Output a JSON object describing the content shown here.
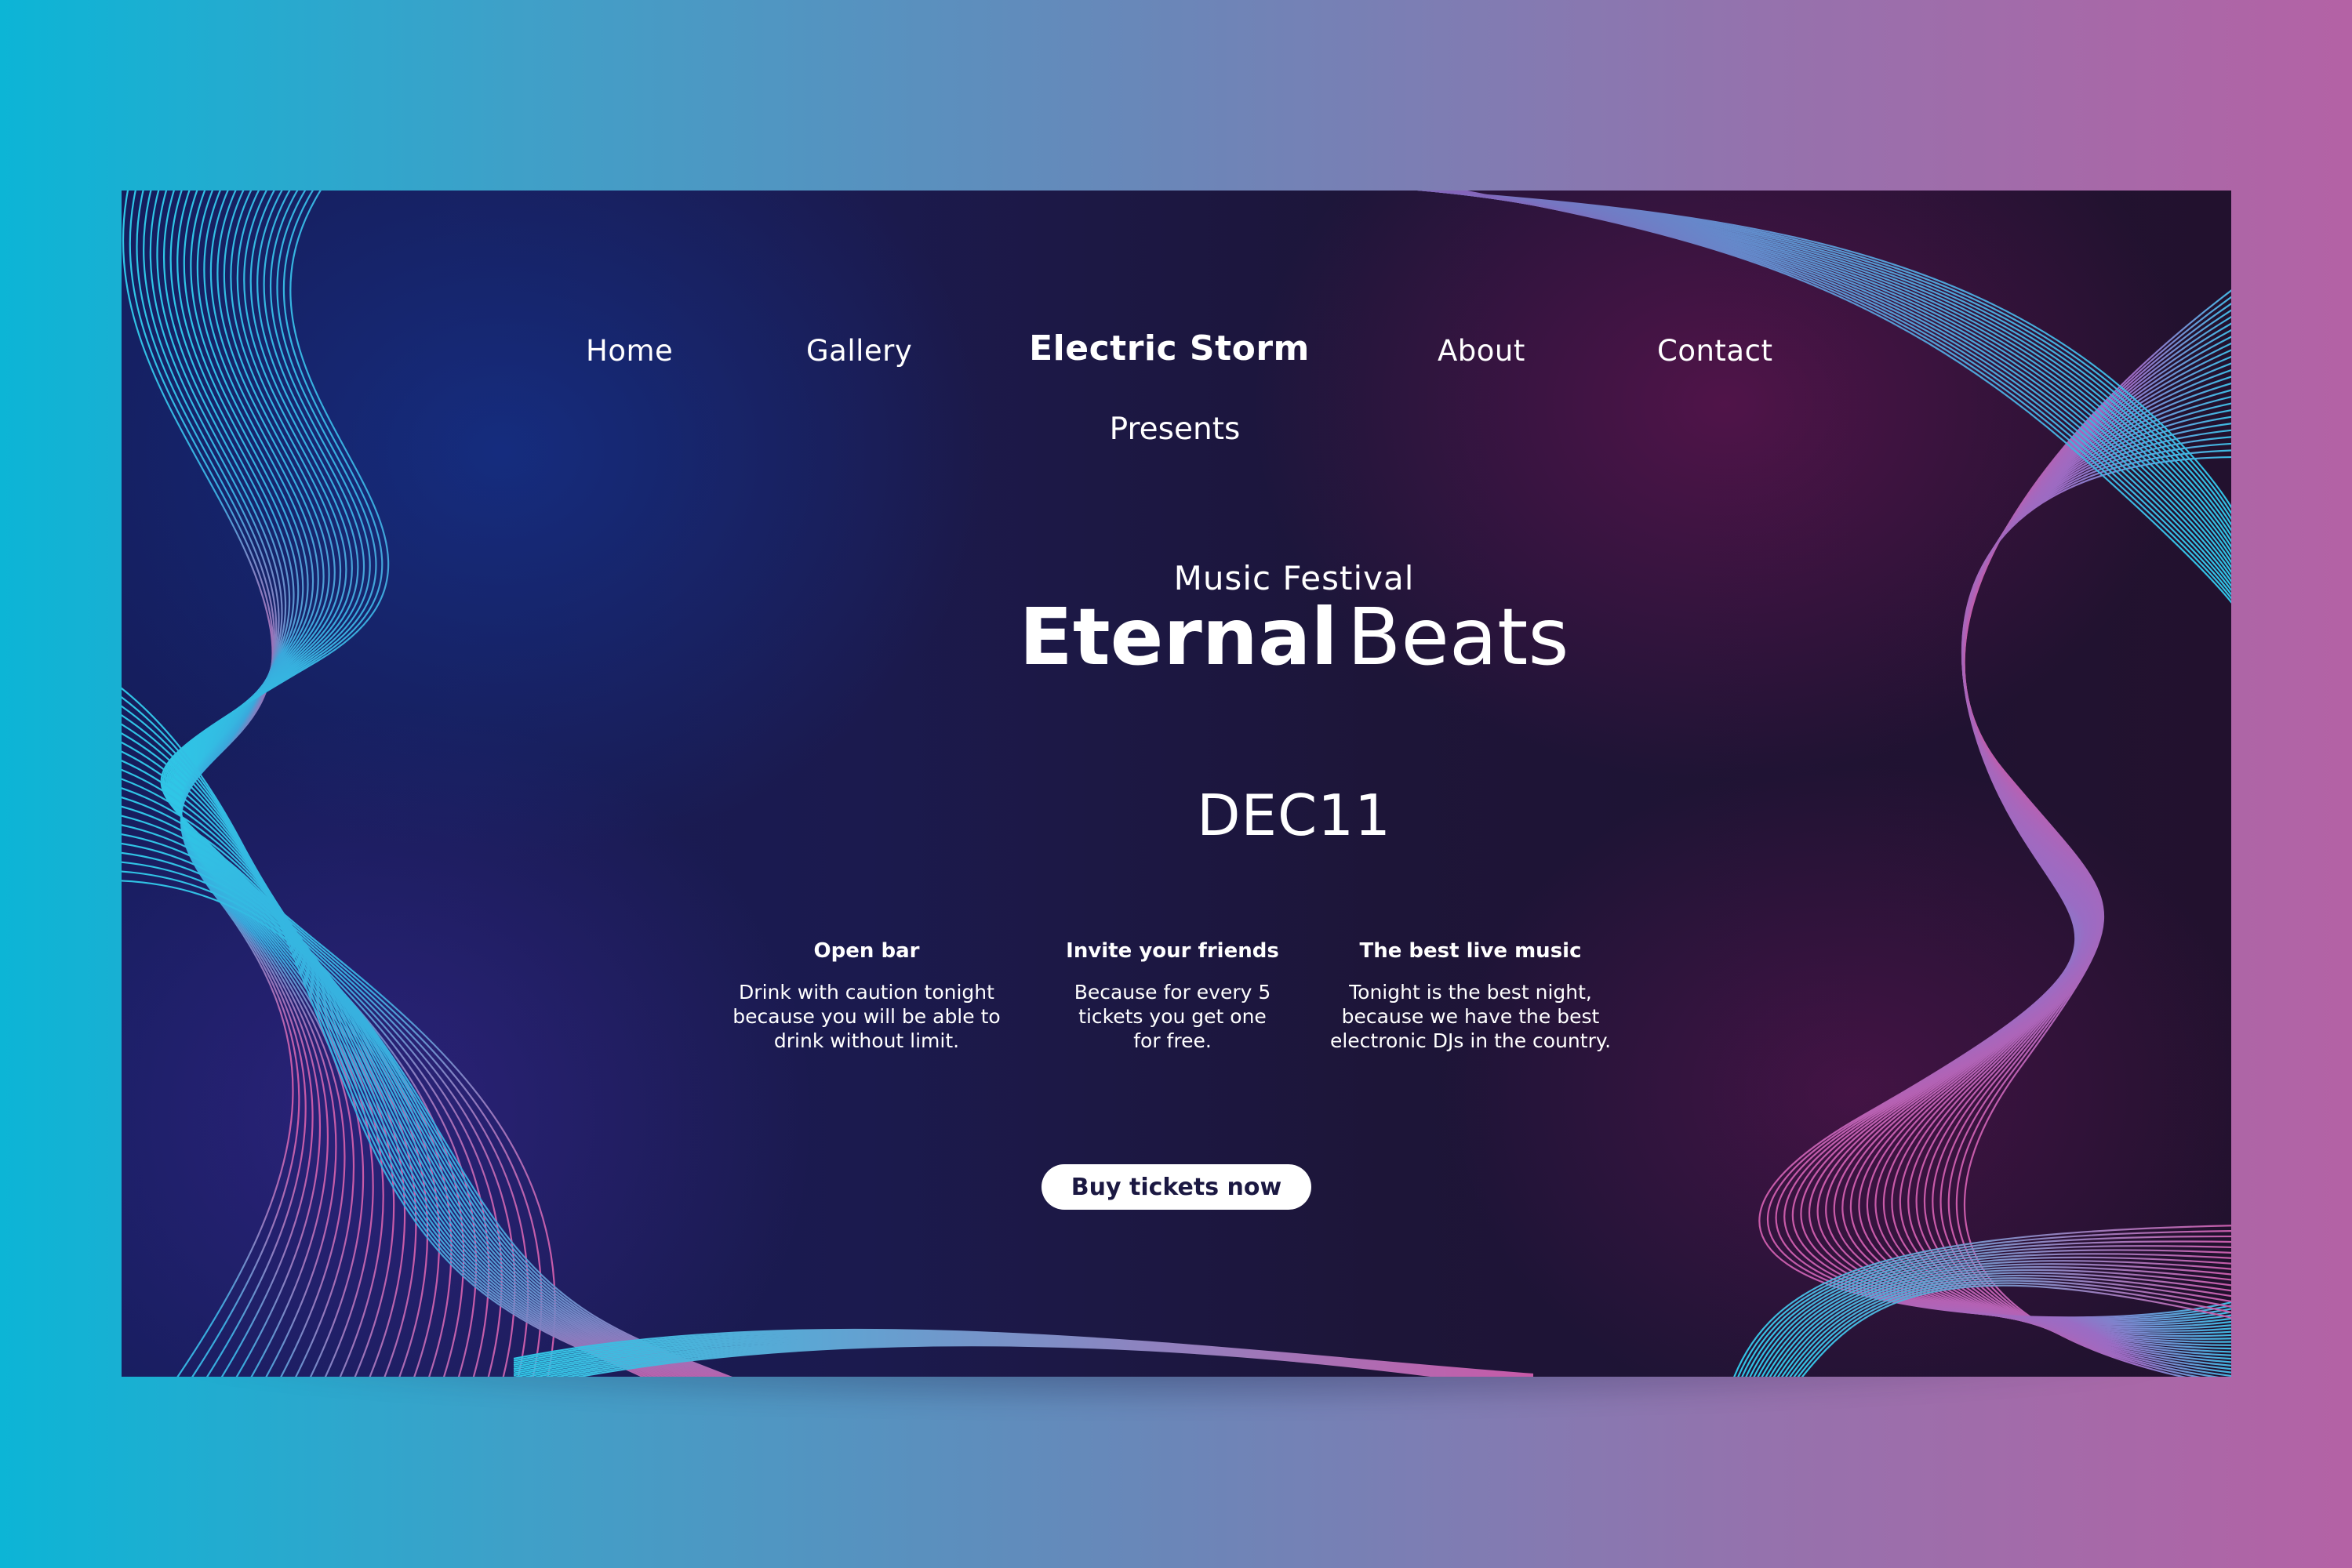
{
  "nav": {
    "items": [
      {
        "label": "Home"
      },
      {
        "label": "Gallery"
      },
      {
        "label": "About"
      },
      {
        "label": "Contact"
      }
    ],
    "brand": "Electric Storm",
    "brand_sub": "Presents"
  },
  "hero": {
    "subtitle": "Music Festival",
    "title_bold": "Eternal",
    "title_light": "Beats",
    "date": "DEC11"
  },
  "features": [
    {
      "title": "Open bar",
      "lines": [
        "Drink with caution tonight",
        "because you will be able to",
        "drink without limit."
      ]
    },
    {
      "title": "Invite your friends",
      "lines": [
        "Because for every 5",
        "tickets you get one",
        "for free."
      ]
    },
    {
      "title": "The best live music",
      "lines": [
        "Tonight is the best night,",
        "because we have the best",
        "electronic DJs in the country."
      ]
    }
  ],
  "cta": {
    "label": "Buy tickets now"
  },
  "colors": {
    "background_left": "#0cb5d6",
    "background_right": "#b462a5",
    "panel_dark": "#1b1a4e",
    "line_cyan": "#2fc6e6",
    "line_pink": "#c85aa8",
    "button_bg": "#ffffff"
  }
}
